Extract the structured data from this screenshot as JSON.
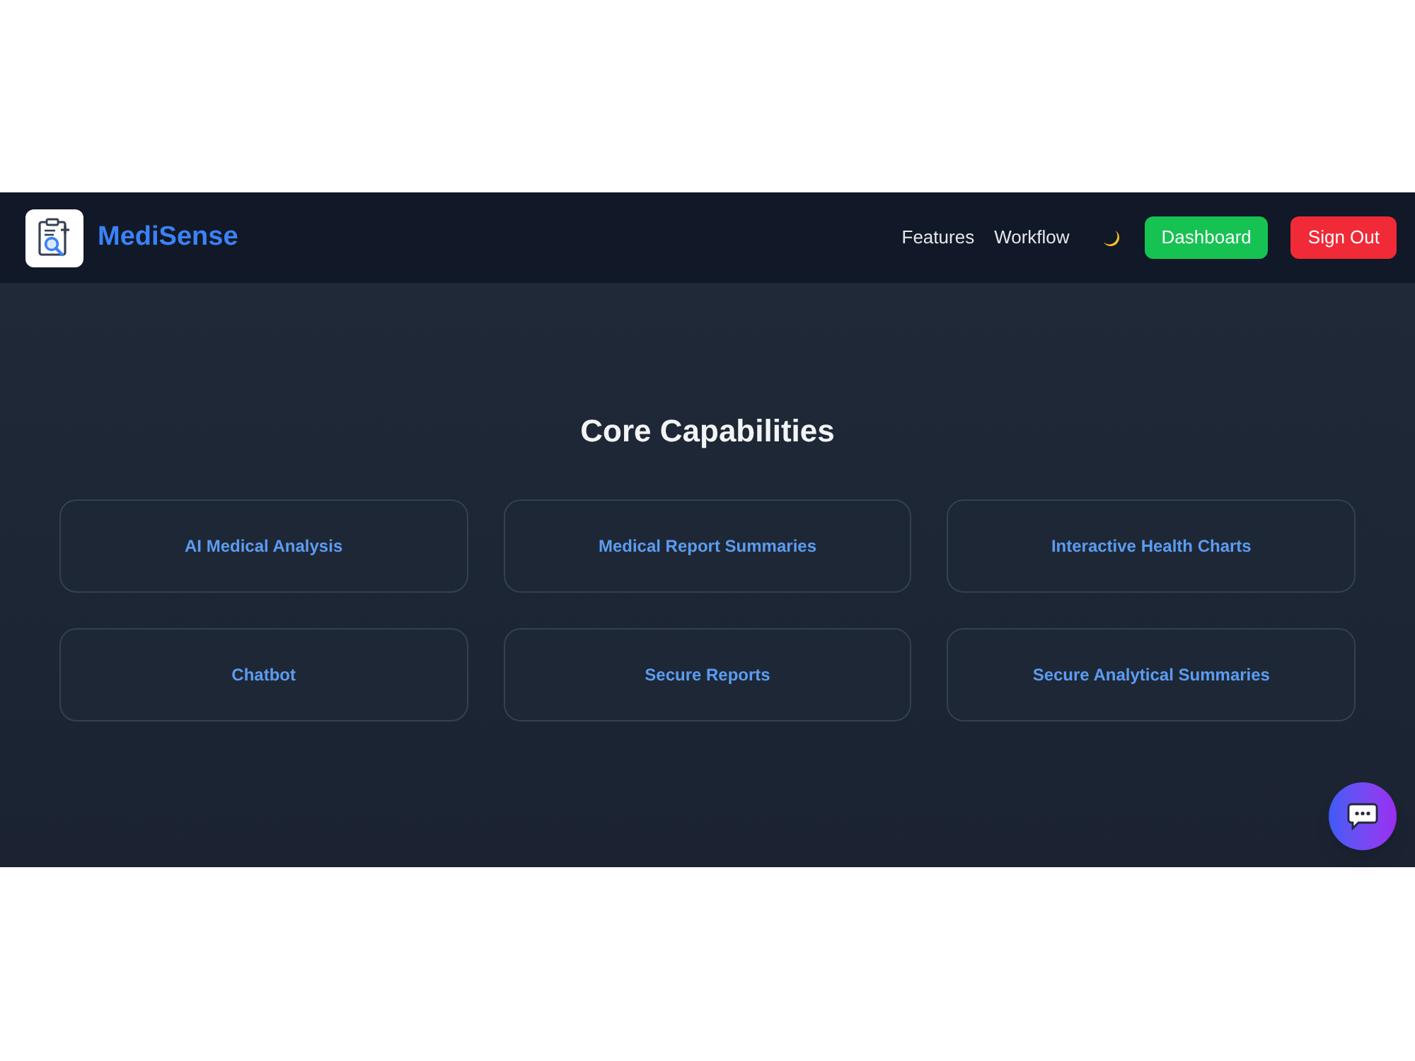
{
  "navbar": {
    "brand": "MediSense",
    "links": [
      {
        "label": "Features"
      },
      {
        "label": "Workflow"
      }
    ],
    "buttons": [
      {
        "label": "Dashboard",
        "kind": "primary"
      },
      {
        "label": "Sign Out",
        "kind": "danger"
      }
    ]
  },
  "section": {
    "title": "Core Capabilities",
    "features": [
      {
        "label": "AI Medical Analysis"
      },
      {
        "label": "Medical Report Summaries"
      },
      {
        "label": "Interactive Health Charts"
      },
      {
        "label": "Chatbot"
      },
      {
        "label": "Secure Reports"
      },
      {
        "label": "Secure Analytical Summaries"
      }
    ]
  }
}
